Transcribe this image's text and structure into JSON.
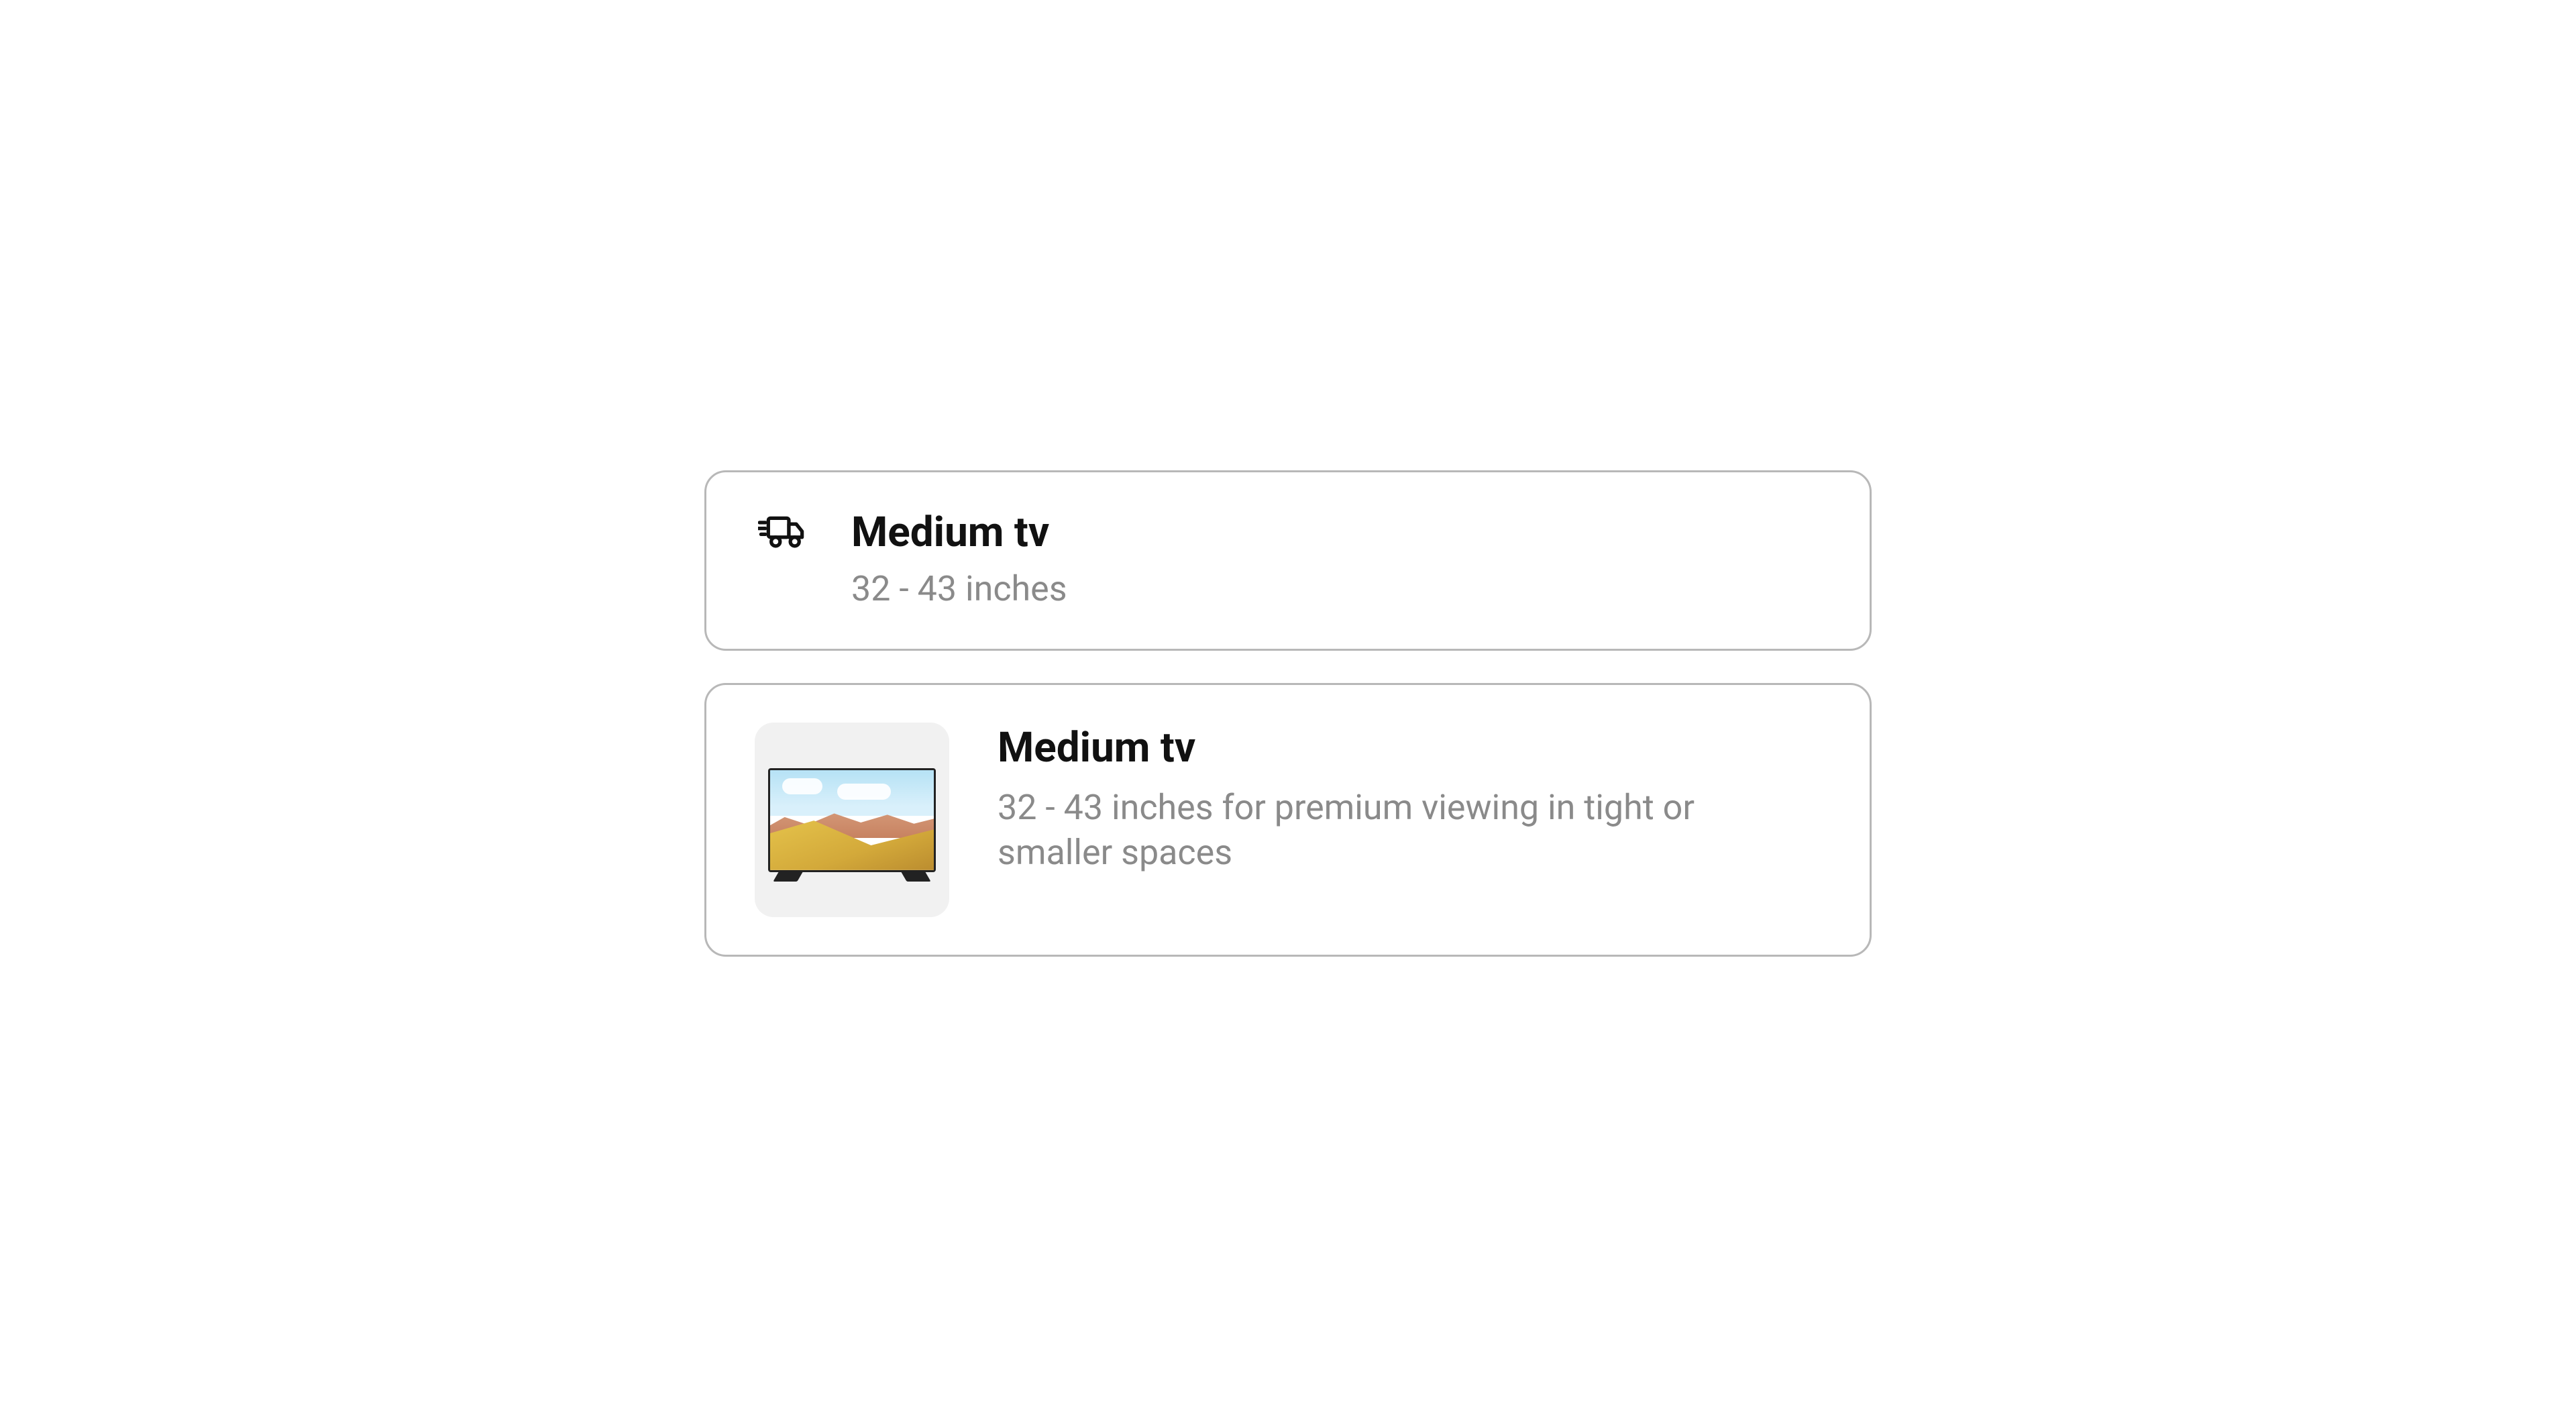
{
  "cards": [
    {
      "icon": "truck-fast-icon",
      "title": "Medium tv",
      "subtitle": "32 - 43 inches"
    },
    {
      "image": "tv-thumbnail",
      "title": "Medium tv",
      "subtitle": "32 - 43 inches for premium viewing in tight or smaller spaces"
    }
  ]
}
